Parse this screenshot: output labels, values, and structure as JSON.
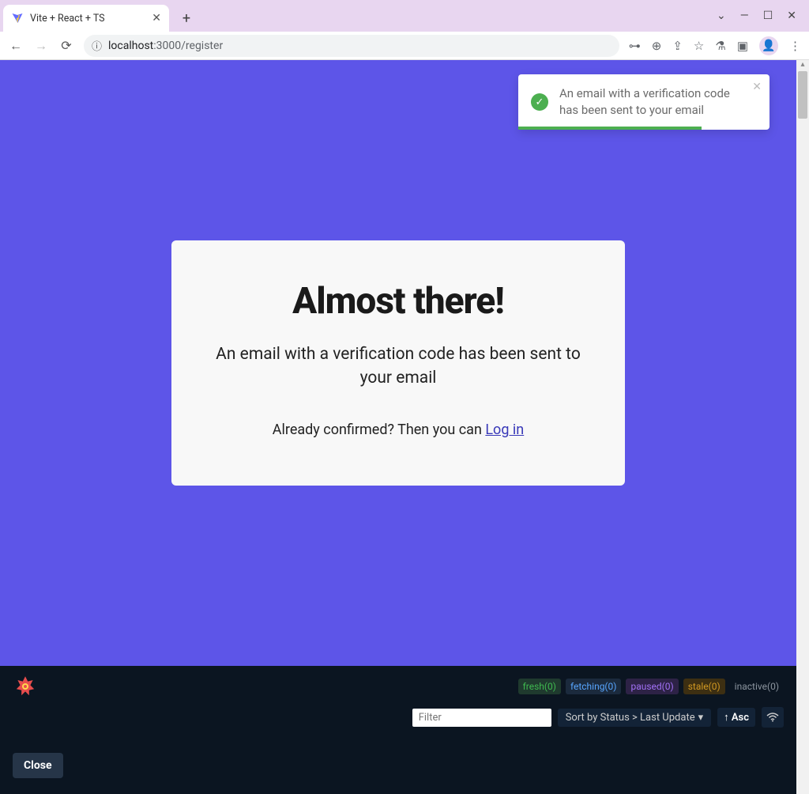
{
  "browser": {
    "tab_title": "Vite + React + TS",
    "url_host": "localhost",
    "url_port_path": ":3000/register"
  },
  "toast": {
    "message": "An email with a verification code has been sent to your email"
  },
  "card": {
    "heading": "Almost there!",
    "subtitle": "An email with a verification code has been sent to your email",
    "prompt_prefix": "Already confirmed? Then you can ",
    "login_link": "Log in"
  },
  "devtools": {
    "badges": {
      "fresh": "fresh(0)",
      "fetching": "fetching(0)",
      "paused": "paused(0)",
      "stale": "stale(0)",
      "inactive": "inactive(0)"
    },
    "filter_placeholder": "Filter",
    "sort_label": "Sort by Status > Last Update",
    "asc_label": "↑ Asc",
    "close_label": "Close"
  }
}
